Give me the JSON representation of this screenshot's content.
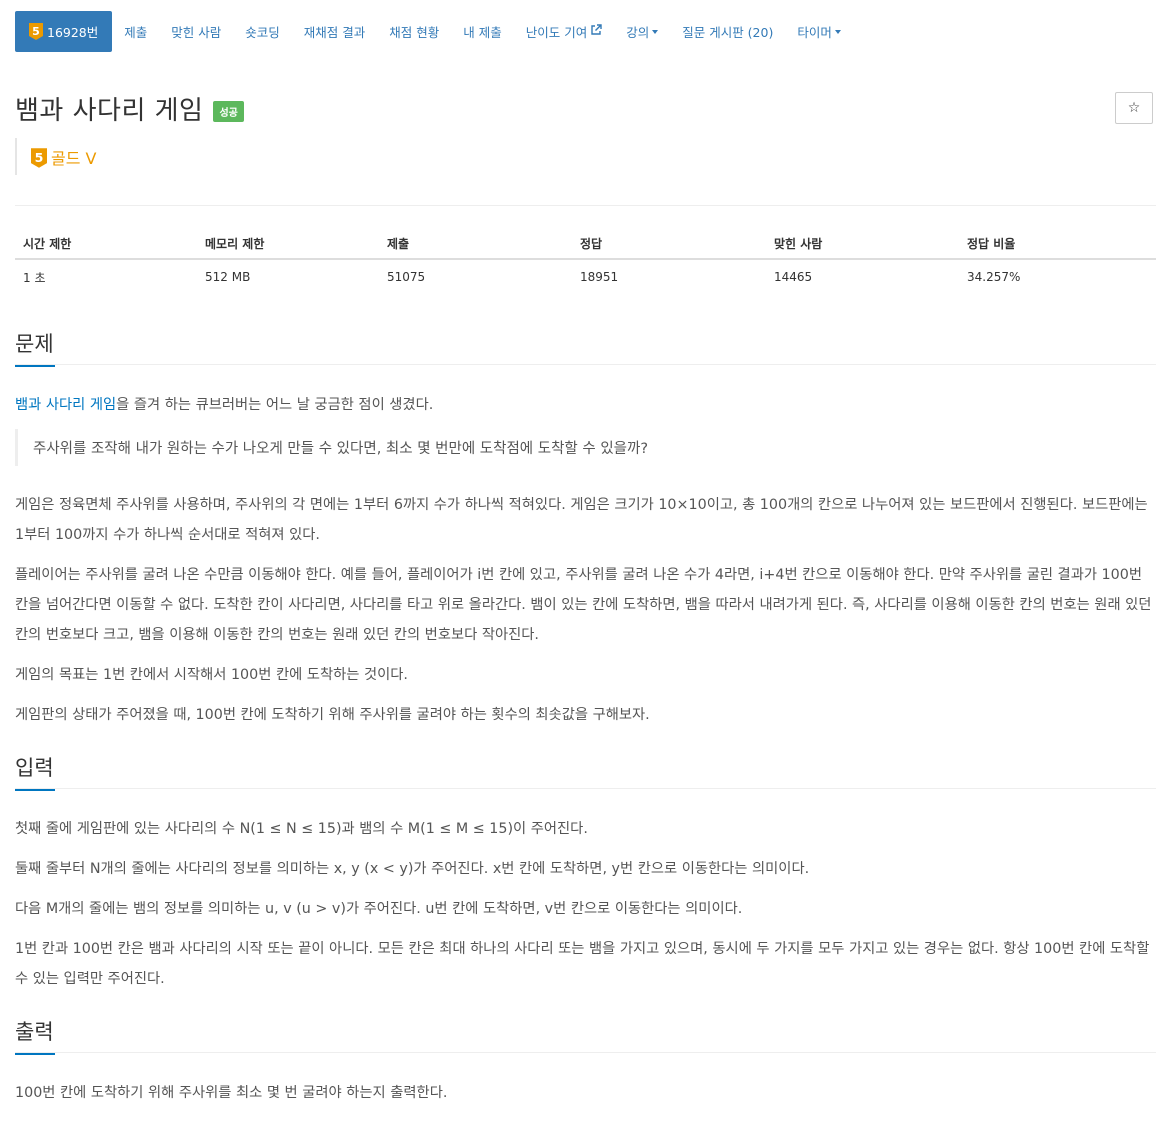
{
  "nav": {
    "problem_number": "16928번",
    "items": [
      "제출",
      "맞힌 사람",
      "숏코딩",
      "재채점 결과",
      "채점 현황",
      "내 제출",
      "난이도 기여",
      "강의",
      "질문 게시판 (20)",
      "타이머"
    ]
  },
  "header": {
    "title": "뱀과 사다리 게임",
    "status_label": "성공",
    "star": "☆",
    "tier_number": "5",
    "tier_text": "골드 V"
  },
  "info": {
    "headers": [
      "시간 제한",
      "메모리 제한",
      "제출",
      "정답",
      "맞힌 사람",
      "정답 비율"
    ],
    "values": [
      "1 초",
      "512 MB",
      "51075",
      "18951",
      "14465",
      "34.257%"
    ]
  },
  "sections": {
    "problem_title": "문제",
    "input_title": "입력",
    "output_title": "출력"
  },
  "problem": {
    "intro_link": "뱀과 사다리 게임",
    "intro_rest": "을 즐겨 하는 큐브러버는 어느 날 궁금한 점이 생겼다.",
    "quote": "주사위를 조작해 내가 원하는 수가 나오게 만들 수 있다면, 최소 몇 번만에 도착점에 도착할 수 있을까?",
    "p1": "게임은 정육면체 주사위를 사용하며, 주사위의 각 면에는 1부터 6까지 수가 하나씩 적혀있다. 게임은 크기가 10×10이고, 총 100개의 칸으로 나누어져 있는 보드판에서 진행된다. 보드판에는 1부터 100까지 수가 하나씩 순서대로 적혀져 있다.",
    "p2": "플레이어는 주사위를 굴려 나온 수만큼 이동해야 한다. 예를 들어, 플레이어가 i번 칸에 있고, 주사위를 굴려 나온 수가 4라면, i+4번 칸으로 이동해야 한다. 만약 주사위를 굴린 결과가 100번 칸을 넘어간다면 이동할 수 없다. 도착한 칸이 사다리면, 사다리를 타고 위로 올라간다. 뱀이 있는 칸에 도착하면, 뱀을 따라서 내려가게 된다. 즉, 사다리를 이용해 이동한 칸의 번호는 원래 있던 칸의 번호보다 크고, 뱀을 이용해 이동한 칸의 번호는 원래 있던 칸의 번호보다 작아진다.",
    "p3": "게임의 목표는 1번 칸에서 시작해서 100번 칸에 도착하는 것이다.",
    "p4": "게임판의 상태가 주어졌을 때, 100번 칸에 도착하기 위해 주사위를 굴려야 하는 횟수의 최솟값을 구해보자."
  },
  "input": {
    "p1": "첫째 줄에 게임판에 있는 사다리의 수 N(1 ≤ N ≤ 15)과 뱀의 수 M(1 ≤ M ≤ 15)이 주어진다.",
    "p2": "둘째 줄부터 N개의 줄에는 사다리의 정보를 의미하는 x, y (x < y)가 주어진다. x번 칸에 도착하면, y번 칸으로 이동한다는 의미이다.",
    "p3": "다음 M개의 줄에는 뱀의 정보를 의미하는 u, v (u > v)가 주어진다. u번 칸에 도착하면, v번 칸으로 이동한다는 의미이다.",
    "p4": "1번 칸과 100번 칸은 뱀과 사다리의 시작 또는 끝이 아니다. 모든 칸은 최대 하나의 사다리 또는 뱀을 가지고 있으며, 동시에 두 가지를 모두 가지고 있는 경우는 없다. 항상 100번 칸에 도착할 수 있는 입력만 주어진다."
  },
  "output": {
    "p1": "100번 칸에 도착하기 위해 주사위를 최소 몇 번 굴려야 하는지 출력한다."
  },
  "colors": {
    "nav_active_bg": "#337ab7",
    "link": "#0076c0",
    "success": "#5cb85c",
    "gold_tier": "#ec9a00"
  },
  "icons": [
    "gold-tier-badge-icon",
    "external-link-icon",
    "caret-down-icon",
    "star-icon"
  ]
}
